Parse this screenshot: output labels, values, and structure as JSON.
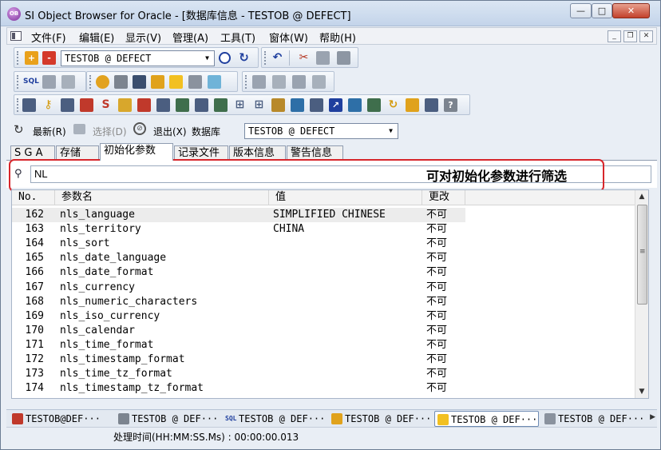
{
  "window": {
    "title": "SI Object Browser for Oracle - [数据库信息 - TESTOB @ DEFECT]",
    "app_icon_text": "OB",
    "minimize_glyph": "—",
    "maximize_glyph": "□",
    "close_glyph": "✕"
  },
  "menu": {
    "items": [
      "文件(F)",
      "编辑(E)",
      "显示(V)",
      "管理(A)",
      "工具(T)",
      "窗体(W)",
      "帮助(H)"
    ],
    "mdi_min": "_",
    "mdi_restore": "❐",
    "mdi_close": "✕"
  },
  "toolbar": {
    "connection_combo": "TESTOB @ DEFECT"
  },
  "navbar": {
    "refresh_label": "最新(R)",
    "select_label": "选择(D)",
    "exit_label": "退出(X)",
    "database_label": "数据库",
    "database_combo": "TESTOB @ DEFECT"
  },
  "tabs": [
    "S G A",
    "存储",
    "初始化参数",
    "记录文件",
    "版本信息",
    "警告信息"
  ],
  "active_tab": "初始化参数",
  "filter": {
    "value": "NL",
    "annotation": "可对初始化参数进行筛选"
  },
  "table": {
    "columns": [
      "No.",
      "参数名",
      "值",
      "更改"
    ],
    "rows": [
      {
        "no": "162",
        "name": "nls_language",
        "value": "SIMPLIFIED CHINESE",
        "change": "不可"
      },
      {
        "no": "163",
        "name": "nls_territory",
        "value": "CHINA",
        "change": "不可"
      },
      {
        "no": "164",
        "name": "nls_sort",
        "value": "",
        "change": "不可"
      },
      {
        "no": "165",
        "name": "nls_date_language",
        "value": "",
        "change": "不可"
      },
      {
        "no": "166",
        "name": "nls_date_format",
        "value": "",
        "change": "不可"
      },
      {
        "no": "167",
        "name": "nls_currency",
        "value": "",
        "change": "不可"
      },
      {
        "no": "168",
        "name": "nls_numeric_characters",
        "value": "",
        "change": "不可"
      },
      {
        "no": "169",
        "name": "nls_iso_currency",
        "value": "",
        "change": "不可"
      },
      {
        "no": "170",
        "name": "nls_calendar",
        "value": "",
        "change": "不可"
      },
      {
        "no": "171",
        "name": "nls_time_format",
        "value": "",
        "change": "不可"
      },
      {
        "no": "172",
        "name": "nls_timestamp_format",
        "value": "",
        "change": "不可"
      },
      {
        "no": "173",
        "name": "nls_time_tz_format",
        "value": "",
        "change": "不可"
      },
      {
        "no": "174",
        "name": "nls_timestamp_tz_format",
        "value": "",
        "change": "不可"
      }
    ]
  },
  "window_tabs": [
    "TESTOB@DEF···",
    "TESTOB @ DEF···",
    "TESTOB @ DEF···",
    "TESTOB @ DEF···",
    "TESTOB @ DEF···",
    "TESTOB @ DEF···"
  ],
  "status": {
    "text": "处理时间(HH:MM:SS.Ms) : 00:00:00.013"
  },
  "colors": {
    "annotation_border": "#d7262b",
    "title_gradient_top": "#dbe6f3",
    "close_button": "#c2412b"
  }
}
